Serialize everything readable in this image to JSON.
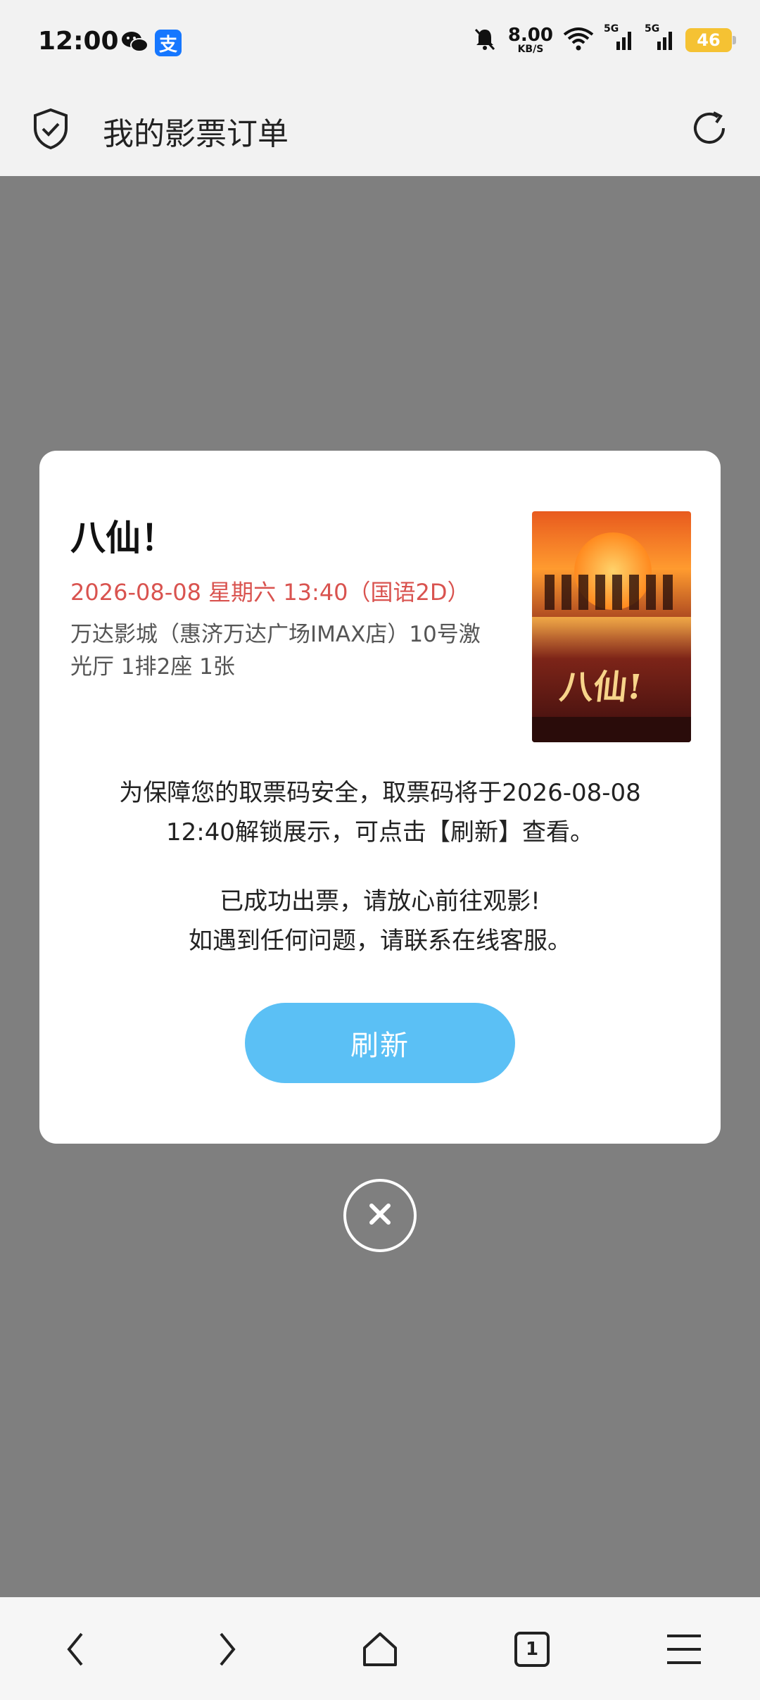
{
  "status_bar": {
    "time": "12:00",
    "app_icons": [
      "wechat-icon",
      "alipay-icon"
    ],
    "alipay_glyph": "支",
    "net_speed_value": "8.00",
    "net_speed_unit": "KB/S",
    "signal_1_label": "5G",
    "signal_2_label": "5G",
    "battery": "46",
    "icons": [
      "mute-bell-icon",
      "wifi-icon",
      "signal-icon",
      "signal-icon",
      "battery-icon"
    ]
  },
  "header": {
    "title": "我的影票订单",
    "left_icon": "shield-check-icon",
    "right_icon": "refresh-icon"
  },
  "modal": {
    "movie_title": "八仙！",
    "showtime": "2026-08-08 星期六 13:40（国语2D）",
    "venue": "万达影城（惠济万达广场IMAX店）10号激光厅 1排2座 1张",
    "notice_line1": "为保障您的取票码安全，取票码将于2026-08-08",
    "notice_line2": "12:40解锁展示，可点击【刷新】查看。",
    "success_line1": "已成功出票，请放心前往观影!",
    "success_line2": "如遇到任何问题，请联系在线客服。",
    "refresh_label": "刷新",
    "poster_title_text": "八仙!",
    "colors": {
      "showtime": "#d9534f",
      "button": "#5bc0f5"
    }
  },
  "overlay_color": "#7f7f7f",
  "bottom_nav": {
    "items": [
      "back-icon",
      "forward-icon",
      "home-icon",
      "tabs-icon",
      "menu-icon"
    ],
    "tab_count": "1"
  }
}
